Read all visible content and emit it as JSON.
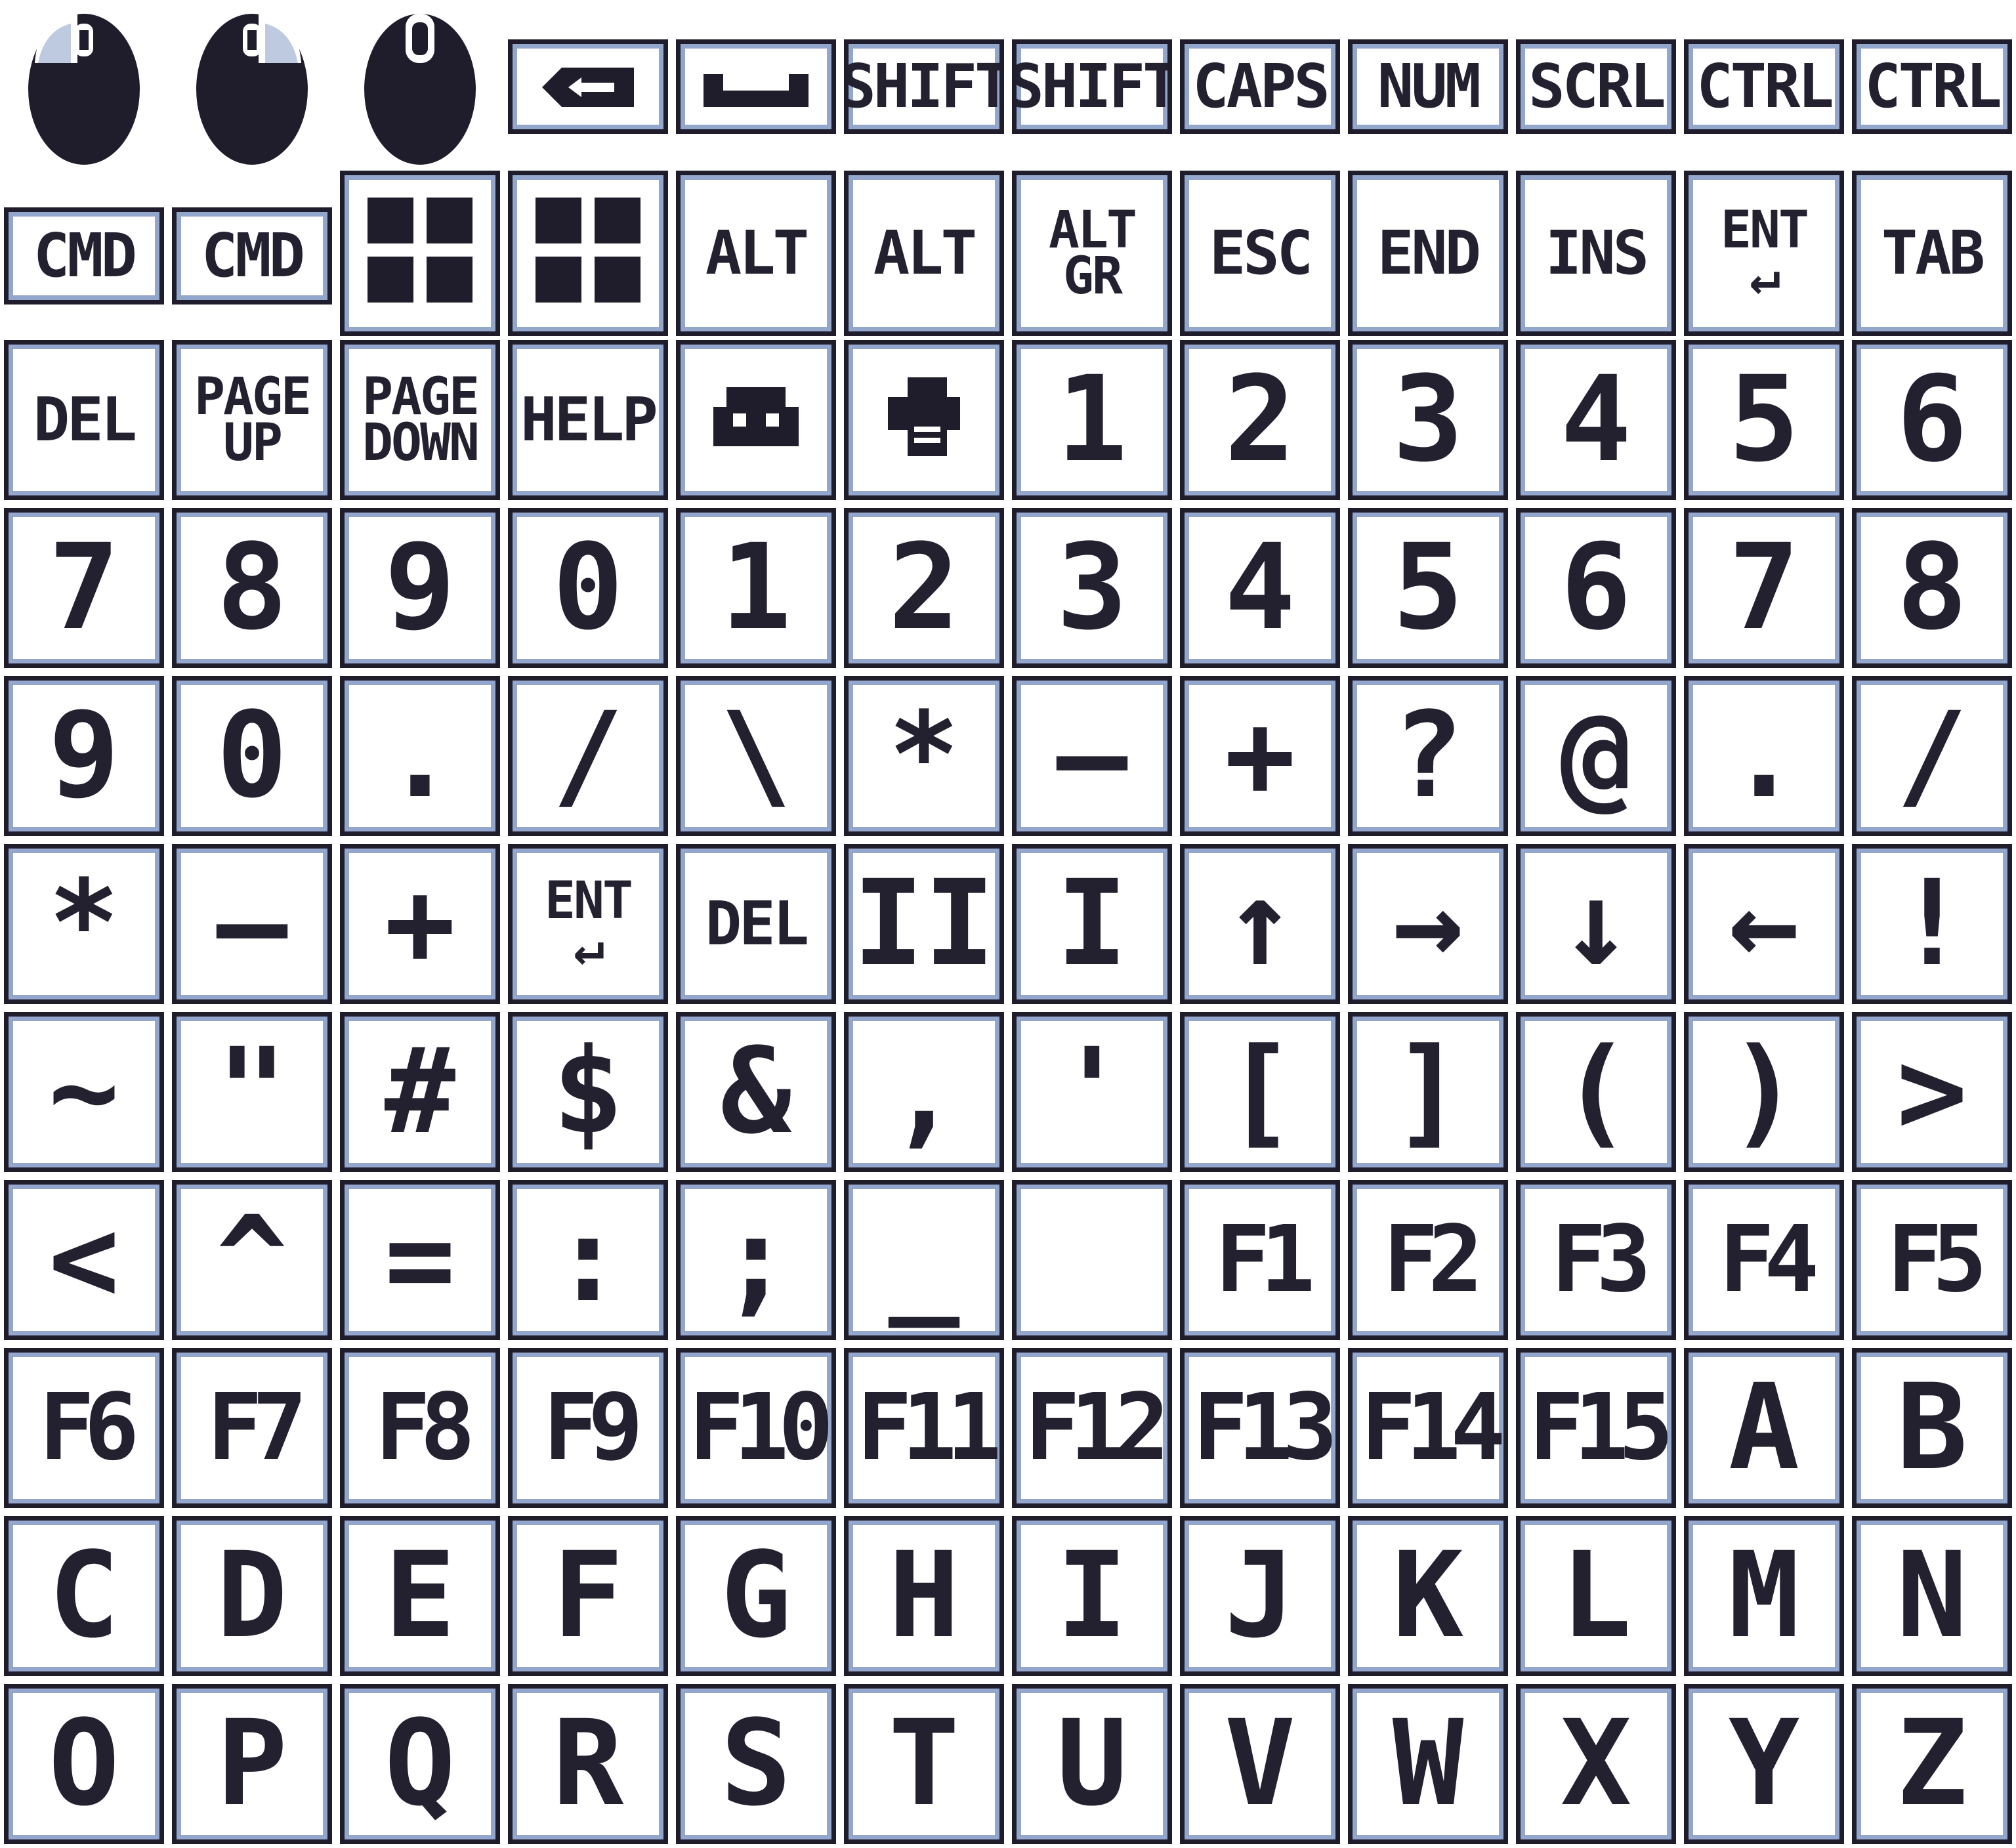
{
  "palette": {
    "ink": "#1f1d2b",
    "edge": "#93a6cc",
    "face": "#ffffff"
  },
  "mice": [
    {
      "name": "mouse-left-button-icon"
    },
    {
      "name": "mouse-right-button-icon"
    },
    {
      "name": "mouse-wheel-icon"
    }
  ],
  "row0": [
    {
      "label": "",
      "icon": "backspace-arrow-icon"
    },
    {
      "label": "",
      "icon": "space-bar-icon"
    },
    {
      "label": "SHIFT"
    },
    {
      "label": "SHIFT"
    },
    {
      "label": "CAPS"
    },
    {
      "label": "NUM"
    },
    {
      "label": "SCRL"
    },
    {
      "label": "CTRL"
    },
    {
      "label": "CTRL"
    }
  ],
  "row1": [
    {
      "label": "CMD"
    },
    {
      "label": "CMD"
    },
    {
      "label": "",
      "icon": "windows-logo-icon"
    },
    {
      "label": "",
      "icon": "windows-logo-icon"
    },
    {
      "label": "ALT"
    },
    {
      "label": "ALT"
    },
    {
      "label": "ALT\nGR"
    },
    {
      "label": "ESC"
    },
    {
      "label": "END"
    },
    {
      "label": "INS"
    },
    {
      "label": "ENT\n↵"
    },
    {
      "label": "TAB"
    }
  ],
  "row2": [
    {
      "label": "DEL"
    },
    {
      "label": "PAGE\nUP"
    },
    {
      "label": "PAGE\nDOWN"
    },
    {
      "label": "HELP"
    },
    {
      "label": "",
      "icon": "home-icon"
    },
    {
      "label": "",
      "icon": "printer-icon"
    },
    {
      "label": "1"
    },
    {
      "label": "2"
    },
    {
      "label": "3"
    },
    {
      "label": "4"
    },
    {
      "label": "5"
    },
    {
      "label": "6"
    }
  ],
  "row3": [
    "7",
    "8",
    "9",
    "0",
    "1",
    "2",
    "3",
    "4",
    "5",
    "6",
    "7",
    "8"
  ],
  "row4": [
    "9",
    "0",
    ".",
    "/",
    "\\",
    "*",
    "—",
    "+",
    "?",
    "@",
    ".",
    "/"
  ],
  "row5": [
    "*",
    "—",
    "+",
    "ENT\n↵",
    "DEL",
    "II",
    "I",
    "↑",
    "→",
    "↓",
    "←",
    "!"
  ],
  "row6": [
    "~",
    "\"",
    "#",
    "$",
    "&",
    ",",
    "'",
    "[",
    "]",
    "(",
    ")",
    ">"
  ],
  "row7": [
    "<",
    "^",
    "=",
    ":",
    ";",
    "_",
    "",
    "F1",
    "F2",
    "F3",
    "F4",
    "F5"
  ],
  "row8": [
    "F6",
    "F7",
    "F8",
    "F9",
    "F10",
    "F11",
    "F12",
    "F13",
    "F14",
    "F15",
    "A",
    "B"
  ],
  "row9": [
    "C",
    "D",
    "E",
    "F",
    "G",
    "H",
    "I",
    "J",
    "K",
    "L",
    "M",
    "N"
  ],
  "row10": [
    "O",
    "P",
    "Q",
    "R",
    "S",
    "T",
    "U",
    "V",
    "W",
    "X",
    "Y",
    "Z"
  ]
}
